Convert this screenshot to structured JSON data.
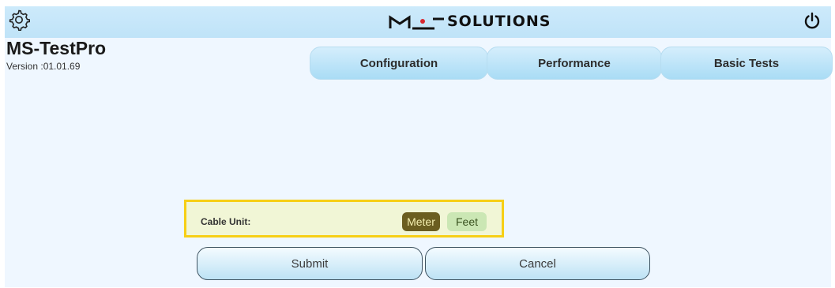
{
  "header": {
    "logo_text": "SOLUTIONS",
    "settings_icon": "gear-icon",
    "power_icon": "power-icon"
  },
  "app": {
    "title": "MS-TestPro",
    "version": "Version :01.01.69"
  },
  "tabs": [
    {
      "label": "Configuration"
    },
    {
      "label": "Performance"
    },
    {
      "label": "Basic Tests"
    }
  ],
  "cable_unit": {
    "label": "Cable Unit:",
    "options": [
      "Meter",
      "Feet"
    ],
    "selected": "Meter"
  },
  "actions": {
    "submit_label": "Submit",
    "cancel_label": "Cancel"
  },
  "colors": {
    "header_bg": "#c4e6f9",
    "page_bg": "#eff7ff",
    "highlight_border": "#f7cf16",
    "selected_option": "#6b5e20",
    "unselected_option": "#cbe7b4"
  }
}
